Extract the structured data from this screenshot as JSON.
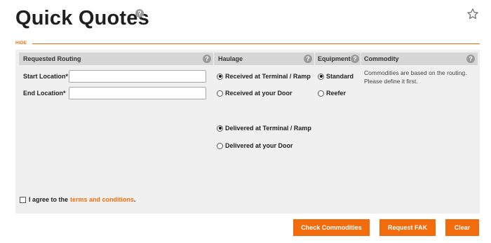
{
  "page": {
    "title": "Quick Quotes",
    "help": "?"
  },
  "toggle": {
    "hide_label": "HIDE"
  },
  "headers": {
    "routing": "Requested Routing",
    "haulage": "Haulage",
    "equipment": "Equipment",
    "commodity": "Commodity",
    "help": "?"
  },
  "routing": {
    "start_label": "Start Location*",
    "start_value": "",
    "end_label": "End Location*",
    "end_value": ""
  },
  "haulage": {
    "received_terminal": "Received at Terminal / Ramp",
    "received_door": "Received at your Door",
    "delivered_terminal": "Delivered at Terminal / Ramp",
    "delivered_door": "Delivered at your Door"
  },
  "equipment": {
    "standard": "Standard",
    "reefer": "Reefer"
  },
  "commodity": {
    "message": "Commodities are based on the routing. Please define it first."
  },
  "agreement": {
    "prefix": "I agree to the",
    "link": "terms and conditions",
    "suffix": "."
  },
  "buttons": {
    "check": "Check Commodities",
    "fak": "Request FAK",
    "clear": "Clear"
  },
  "colors": {
    "accent": "#f26c0d",
    "panel": "#f0f0f0",
    "header": "#d6d6d6"
  },
  "icons": {
    "star": "star-icon",
    "help": "help-icon"
  }
}
